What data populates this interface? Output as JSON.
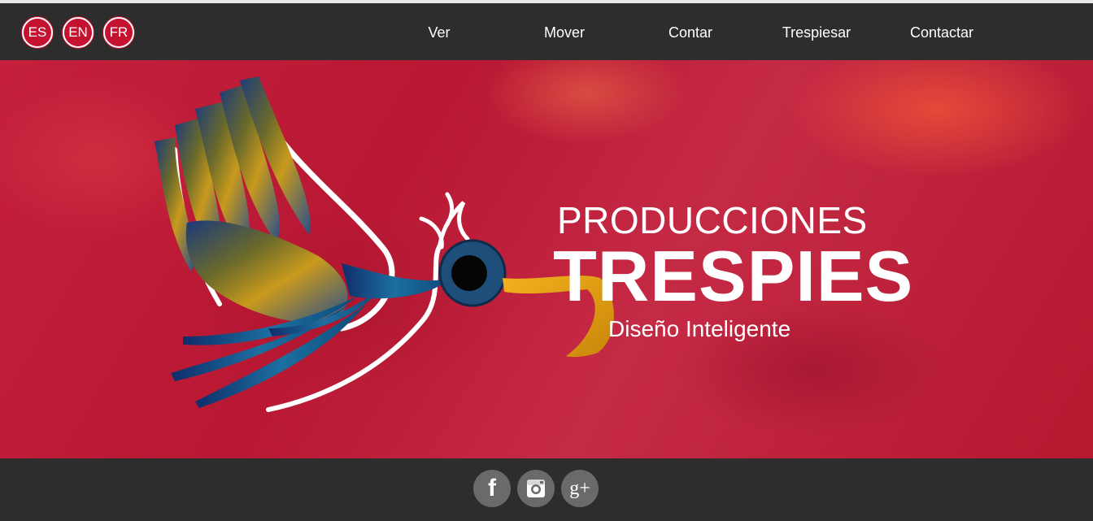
{
  "languages": [
    {
      "code": "ES"
    },
    {
      "code": "EN"
    },
    {
      "code": "FR"
    }
  ],
  "nav": {
    "items": [
      "Ver",
      "Mover",
      "Contar",
      "Trespiesar",
      "Contactar"
    ]
  },
  "hero": {
    "line1": "PRODUCCIONES",
    "line2": "TRESPIES",
    "tagline": "Diseño Inteligente"
  },
  "social": {
    "facebook_glyph": "f",
    "gplus_glyph": "g+"
  },
  "colors": {
    "navbar": "#2d2d2d",
    "language_badge": "#c41230",
    "hero_red": "#b81833",
    "beak": "#e8a20f",
    "social_circle": "#6a6a6a"
  },
  "icons": [
    "facebook-icon",
    "instagram-icon",
    "google-plus-icon"
  ]
}
